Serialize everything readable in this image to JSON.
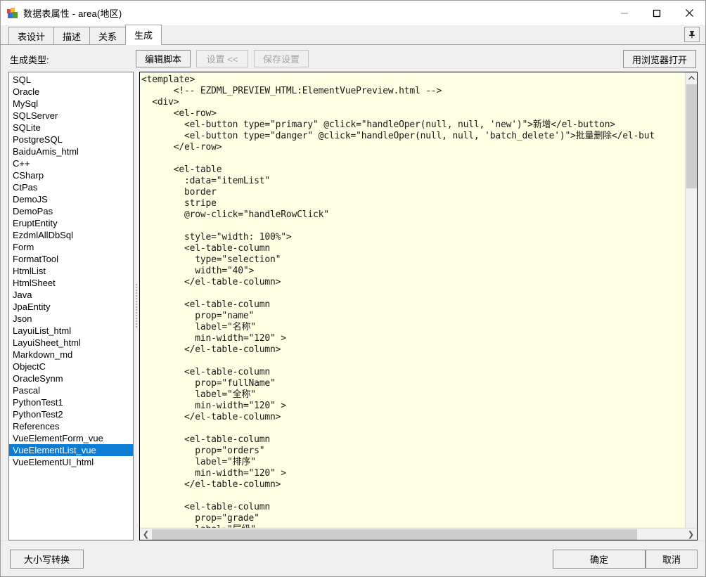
{
  "window": {
    "title": "数据表属性 - area(地区)",
    "icon": "app-data-table-icon",
    "minimize_label": "—",
    "maximize_label": "□",
    "close_label": "✕"
  },
  "tabs": [
    {
      "label": "表设计",
      "active": false
    },
    {
      "label": "描述",
      "active": false
    },
    {
      "label": "关系",
      "active": false
    },
    {
      "label": "生成",
      "active": true
    }
  ],
  "pin": {
    "label": "pin-icon",
    "tooltip": "钉住"
  },
  "toolbar": {
    "generate_type_label": "生成类型:",
    "edit_script": "编辑脚本",
    "settings": "设置 <<",
    "save_settings": "保存设置",
    "open_in_browser": "用浏览器打开"
  },
  "generator_list": {
    "selected": "VueElementList_vue",
    "items": [
      "SQL",
      "Oracle",
      "MySql",
      "SQLServer",
      "SQLite",
      "PostgreSQL",
      "BaiduAmis_html",
      "C++",
      "CSharp",
      "CtPas",
      "DemoJS",
      "DemoPas",
      "EruptEntity",
      "EzdmlAllDbSql",
      "Form",
      "FormatTool",
      "HtmlList",
      "HtmlSheet",
      "Java",
      "JpaEntity",
      "Json",
      "LayuiList_html",
      "LayuiSheet_html",
      "Markdown_md",
      "ObjectC",
      "OracleSynm",
      "Pascal",
      "PythonTest1",
      "PythonTest2",
      "References",
      "VueElementForm_vue",
      "VueElementList_vue",
      "VueElementUI_html"
    ]
  },
  "editor": {
    "code": "<template>\n      <!-- EZDML_PREVIEW_HTML:ElementVuePreview.html -->\n  <div>\n      <el-row>\n        <el-button type=\"primary\" @click=\"handleOper(null, null, 'new')\">新增</el-button>\n        <el-button type=\"danger\" @click=\"handleOper(null, null, 'batch_delete')\">批量删除</el-but\n      </el-row>\n\n      <el-table\n        :data=\"itemList\"\n        border\n        stripe\n        @row-click=\"handleRowClick\"\n\n        style=\"width: 100%\">\n        <el-table-column\n          type=\"selection\"\n          width=\"40\">\n        </el-table-column>\n\n        <el-table-column\n          prop=\"name\"\n          label=\"名称\"\n          min-width=\"120\" >\n        </el-table-column>\n\n        <el-table-column\n          prop=\"fullName\"\n          label=\"全称\"\n          min-width=\"120\" >\n        </el-table-column>\n\n        <el-table-column\n          prop=\"orders\"\n          label=\"排序\"\n          min-width=\"120\" >\n        </el-table-column>\n\n        <el-table-column\n          prop=\"grade\"\n          label=\"层级\"",
    "background_color": "#ffffe4",
    "vscroll_arrow": "▲",
    "hscroll_left_arrow": "❮",
    "hscroll_right_arrow": "❯"
  },
  "footer": {
    "case_convert": "大小写转换",
    "ok": "确定",
    "cancel": "取消"
  },
  "colors": {
    "selection_blue": "#0c7cd5",
    "editor_bg": "#ffffe4",
    "window_bg": "#f0f0f0"
  }
}
